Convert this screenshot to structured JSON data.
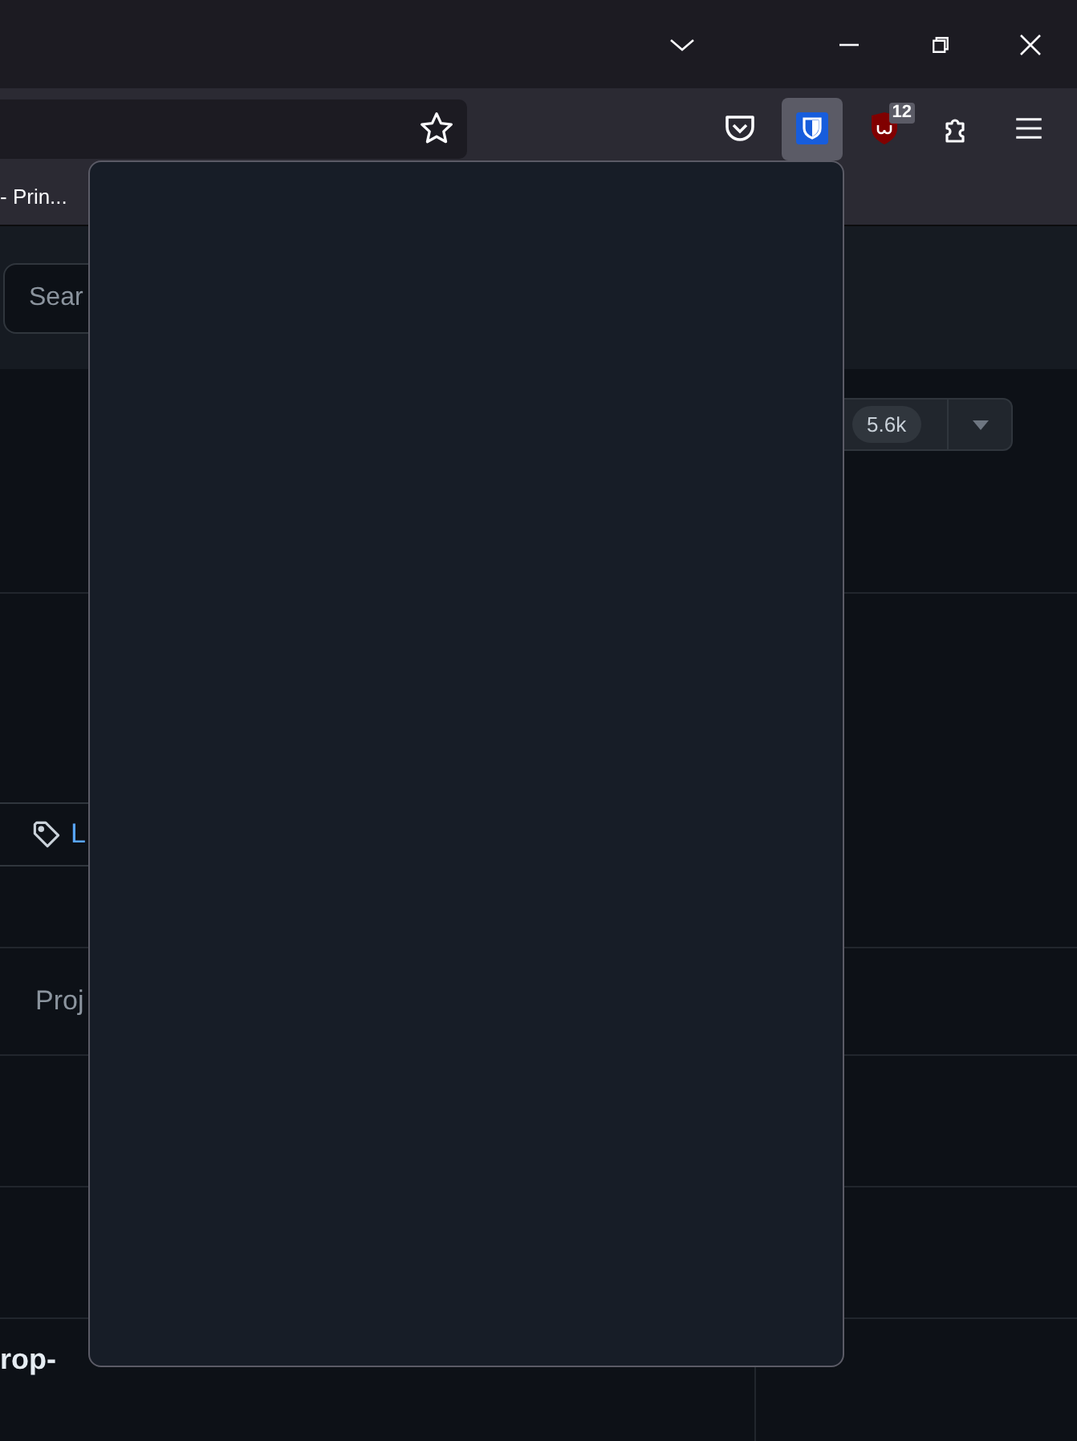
{
  "toolbar": {
    "url_field": {
      "bookmarked": false
    },
    "extensions": [
      {
        "kind": "pocket",
        "selected": false
      },
      {
        "kind": "shield",
        "selected": true
      },
      {
        "kind": "ublock",
        "selected": false,
        "badge": "12"
      },
      {
        "kind": "puzzle",
        "selected": false
      }
    ]
  },
  "bookmarks": [
    "- Prin..."
  ],
  "header": {
    "search": {
      "placeholder": "Sear"
    }
  },
  "repo": {
    "counter": "5.6k",
    "tag_button": "L",
    "tab": "Proj",
    "heading": "rop-"
  }
}
